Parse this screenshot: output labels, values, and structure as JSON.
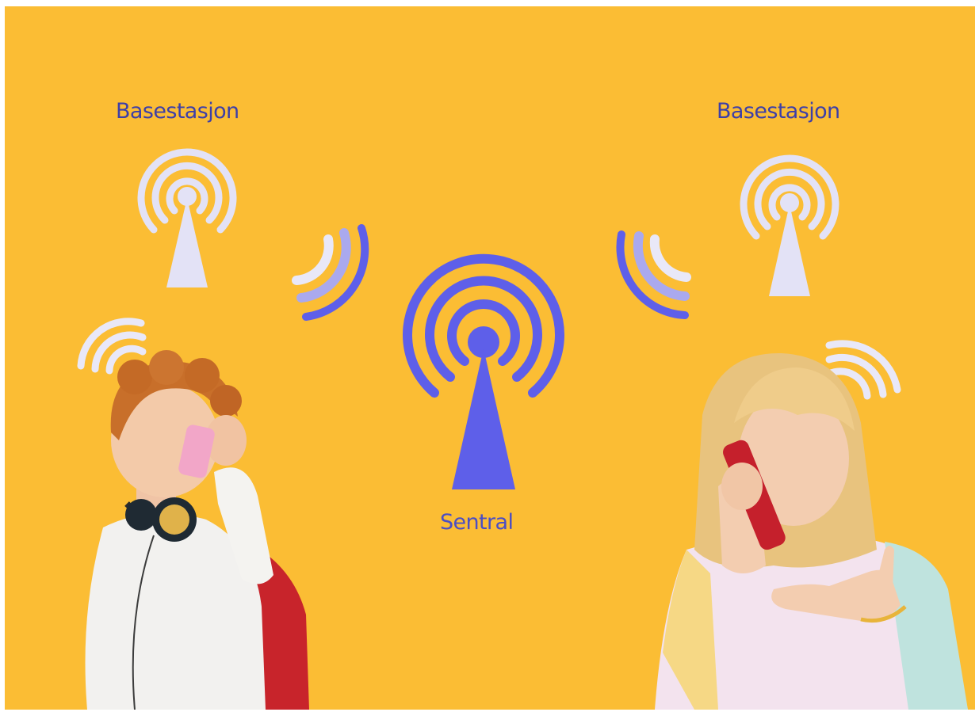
{
  "labels": {
    "left_station": "Basestasjon",
    "right_station": "Basestasjon",
    "central": "Sentral"
  },
  "colors": {
    "background": "#fbbd34",
    "station_icon": "#e3e2f6",
    "central_icon": "#5e5fe9",
    "label_text": "#3d3fa8",
    "wave_light": "#e9e8f8",
    "wave_mid": "#aaa9ee",
    "wave_dark": "#5e5fe9"
  },
  "icons": [
    "antenna-icon",
    "signal-waves-icon",
    "boy-with-phone",
    "girl-with-phone"
  ]
}
